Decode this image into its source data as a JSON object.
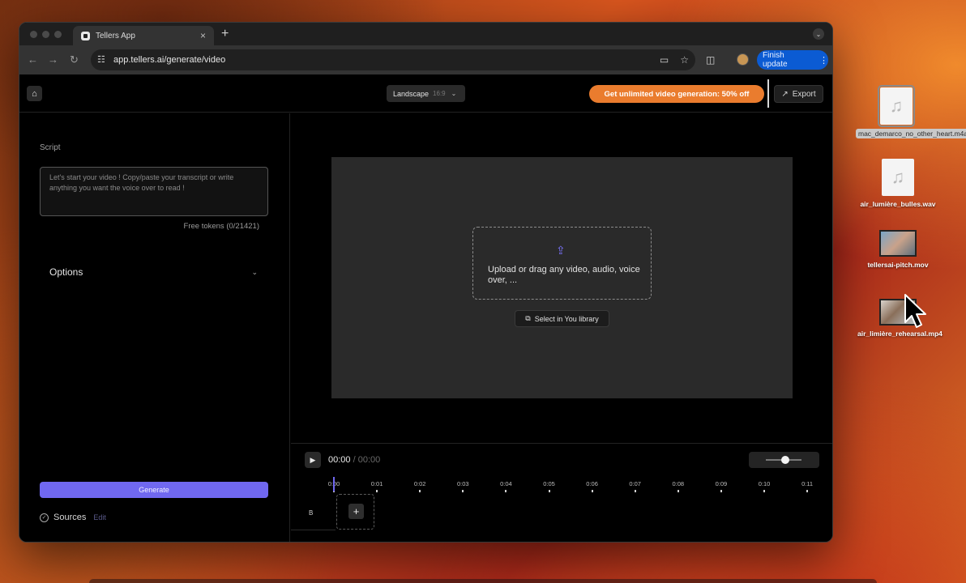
{
  "browser": {
    "tab_title": "Tellers App",
    "tab_close": "×",
    "new_tab": "+",
    "url": "app.tellers.ai/generate/video",
    "finish_update": "Finish update",
    "more_dots": "⋮"
  },
  "app": {
    "header": {
      "landscape_label": "Landscape",
      "aspect_ratio": "16:9",
      "promo_text": "Get unlimited video generation: 50% off",
      "export_label": "Export"
    },
    "script": {
      "label": "Script",
      "placeholder": "Let's start your video ! Copy/paste your transcript or write anything you want the voice over to read !",
      "tokens": "Free tokens (0/21421)"
    },
    "options_label": "Options",
    "generate_label": "Generate",
    "sources": {
      "label": "Sources",
      "edit": "Edit"
    },
    "upload": {
      "text": "Upload or drag any video, audio, voice over, ...",
      "library_label": "Select in You library"
    },
    "timeline": {
      "current_time": "00:00",
      "separator": "/",
      "total_time": "00:00",
      "track_label": "B",
      "zoom_level": 0.55,
      "ticks": [
        "0:00",
        "0:01",
        "0:02",
        "0:03",
        "0:04",
        "0:05",
        "0:06",
        "0:07",
        "0:08",
        "0:09",
        "0:10",
        "0:11"
      ]
    }
  },
  "desktop": {
    "files": [
      {
        "label": "mac_demarco_no_other_heart.m4a",
        "kind": "audio",
        "selected": true
      },
      {
        "label": "air_lumière_bulles.wav",
        "kind": "audio",
        "selected": false
      },
      {
        "label": "tellersai-pitch.mov",
        "kind": "video",
        "selected": false
      },
      {
        "label": "air_limière_rehearsal.mp4",
        "kind": "video",
        "selected": false
      }
    ]
  },
  "colors": {
    "accent": "#7068f0",
    "promo": "#ea7c2e",
    "update_button": "#0b5bd3"
  }
}
